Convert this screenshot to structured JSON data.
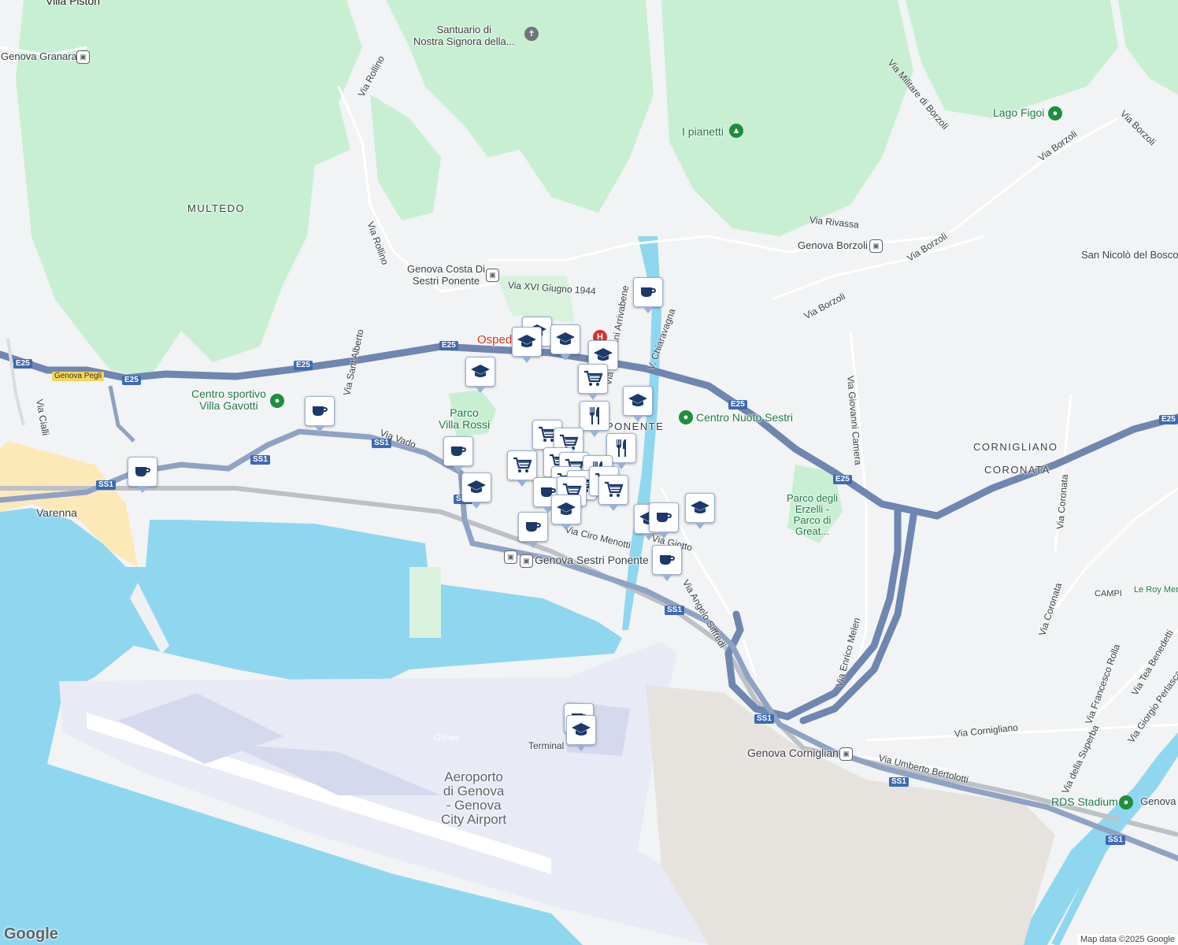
{
  "map": {
    "colors": {
      "water": "#8fd7ee",
      "land": "#f1f3f4",
      "park": "#c8efd2",
      "highway": "#7a92b8",
      "airport": "#e8eaf6",
      "industrial": "#e6e3df",
      "marker": "#1a3a6b"
    },
    "districts": [
      {
        "key": "multedo",
        "text": "MULTEDO"
      },
      {
        "key": "sestri",
        "text": "PONENTE"
      },
      {
        "key": "cornigliano",
        "text": "CORNIGLIANO"
      },
      {
        "key": "coronata",
        "text": "CORONATA"
      },
      {
        "key": "campi",
        "text": "CAMPI"
      }
    ],
    "places": [
      {
        "key": "villa_piston",
        "text": "Villa Piston"
      },
      {
        "key": "santuario",
        "text": "Santuario di\nNostra Signora della..."
      },
      {
        "key": "pianetti",
        "text": "I pianetti"
      },
      {
        "key": "lago_figoi",
        "text": "Lago Figoi"
      },
      {
        "key": "san_nicolo",
        "text": "San Nicolò del Bosco"
      },
      {
        "key": "centro_sportivo",
        "text": "Centro sportivo\nVilla Gavotti"
      },
      {
        "key": "parco_villa_rossi",
        "text": "Parco\nVilla Rossi"
      },
      {
        "key": "centro_nuoto",
        "text": "Centro Nuoto Sestri"
      },
      {
        "key": "parco_erzelli",
        "text": "Parco degli\nErzelli -\nParco di\nGreat..."
      },
      {
        "key": "varenna",
        "text": "Varenna"
      },
      {
        "key": "aeroporto",
        "text": "Aeroporto\ndi Genova\n- Genova\nCity Airport"
      },
      {
        "key": "terminal",
        "text": "Terminal"
      },
      {
        "key": "genes",
        "text": "Gênes"
      },
      {
        "key": "rds_stadium",
        "text": "RDS Stadium"
      },
      {
        "key": "genova_edge",
        "text": "Genova"
      },
      {
        "key": "le_roy",
        "text": "Le Roy Merlin"
      },
      {
        "key": "ospedale",
        "text": "Ospedale"
      }
    ],
    "stations": [
      {
        "key": "granara",
        "text": "Genova Granara"
      },
      {
        "key": "costa",
        "text": "Genova Costa Di\nSestri Ponente"
      },
      {
        "key": "borzoli",
        "text": "Genova Borzoli"
      },
      {
        "key": "sestri_st",
        "text": "Genova Sestri Ponente"
      },
      {
        "key": "cornigliano_st",
        "text": "Genova Cornigliano"
      }
    ],
    "roads": [
      {
        "key": "r1",
        "text": "Via Rollino"
      },
      {
        "key": "r2",
        "text": "Via Rollino"
      },
      {
        "key": "r3",
        "text": "Via Sant'Alberto"
      },
      {
        "key": "r4",
        "text": "Via XVI Giugno 1944"
      },
      {
        "key": "r5",
        "text": "Via Militare di Borzoli"
      },
      {
        "key": "r6",
        "text": "Via Borzoli"
      },
      {
        "key": "r7",
        "text": "Via Borzoli"
      },
      {
        "key": "r8",
        "text": "Via Borzoli"
      },
      {
        "key": "r9",
        "text": "Via Rivassa"
      },
      {
        "key": "r10",
        "text": "Via Borzoli"
      },
      {
        "key": "r11",
        "text": "Via Giovanni Camera"
      },
      {
        "key": "r12",
        "text": "Via Cialli"
      },
      {
        "key": "r13",
        "text": "Via Vado"
      },
      {
        "key": "r14",
        "text": "Via Giovanni Arrivabene"
      },
      {
        "key": "r15",
        "text": "V. Chiaravagna"
      },
      {
        "key": "r16",
        "text": "Via Ciro Menotti"
      },
      {
        "key": "r17",
        "text": "Via Angelo Siffredi"
      },
      {
        "key": "r18",
        "text": "Via Enrico Melen"
      },
      {
        "key": "r19",
        "text": "Via Coronata"
      },
      {
        "key": "r20",
        "text": "Via Coronata"
      },
      {
        "key": "r21",
        "text": "Via Cornigliano"
      },
      {
        "key": "r22",
        "text": "Via Umberto Bertolotti"
      },
      {
        "key": "r23",
        "text": "Via Francesco Rolla"
      },
      {
        "key": "r24",
        "text": "Via della Superba"
      },
      {
        "key": "r25",
        "text": "Via Tea Benedetti"
      },
      {
        "key": "r26",
        "text": "Via Giorgio Perlasca"
      },
      {
        "key": "r27",
        "text": "Via Giotto"
      }
    ],
    "shields": [
      {
        "key": "e25a",
        "text": "E25"
      },
      {
        "key": "e25b",
        "text": "E25"
      },
      {
        "key": "e25c",
        "text": "E25"
      },
      {
        "key": "e25d",
        "text": "E25"
      },
      {
        "key": "e25e",
        "text": "E25"
      },
      {
        "key": "e25f",
        "text": "E25"
      },
      {
        "key": "e25g",
        "text": "E25"
      },
      {
        "key": "ss1a",
        "text": "SS1"
      },
      {
        "key": "ss1b",
        "text": "SS1"
      },
      {
        "key": "ss1c",
        "text": "SS1"
      },
      {
        "key": "ss1d",
        "text": "SS1"
      },
      {
        "key": "ss1e",
        "text": "SS1"
      },
      {
        "key": "ss1f",
        "text": "SS1"
      },
      {
        "key": "ss1g",
        "text": "SS1"
      },
      {
        "key": "ss1h",
        "text": "SS1"
      },
      {
        "key": "pegli",
        "text": "Genova Pegli"
      }
    ],
    "markers": [
      {
        "icon": "coffee"
      },
      {
        "icon": "coffee"
      },
      {
        "icon": "school"
      },
      {
        "icon": "school"
      },
      {
        "icon": "school"
      },
      {
        "icon": "school"
      },
      {
        "icon": "school"
      },
      {
        "icon": "coffee"
      },
      {
        "icon": "cart"
      },
      {
        "icon": "school"
      },
      {
        "icon": "restaurant"
      },
      {
        "icon": "cart"
      },
      {
        "icon": "cart"
      },
      {
        "icon": "restaurant"
      },
      {
        "icon": "coffee"
      },
      {
        "icon": "cart"
      },
      {
        "icon": "cart"
      },
      {
        "icon": "cart"
      },
      {
        "icon": "restaurant"
      },
      {
        "icon": "cart"
      },
      {
        "icon": "cart"
      },
      {
        "icon": "cart"
      },
      {
        "icon": "cart"
      },
      {
        "icon": "coffee"
      },
      {
        "icon": "school"
      },
      {
        "icon": "cart"
      },
      {
        "icon": "school"
      },
      {
        "icon": "school"
      },
      {
        "icon": "school"
      },
      {
        "icon": "coffee"
      },
      {
        "icon": "coffee"
      },
      {
        "icon": "coffee"
      },
      {
        "icon": "coffee"
      },
      {
        "icon": "school"
      }
    ],
    "attribution": "Map data ©2025 Google",
    "logo": "Google"
  }
}
